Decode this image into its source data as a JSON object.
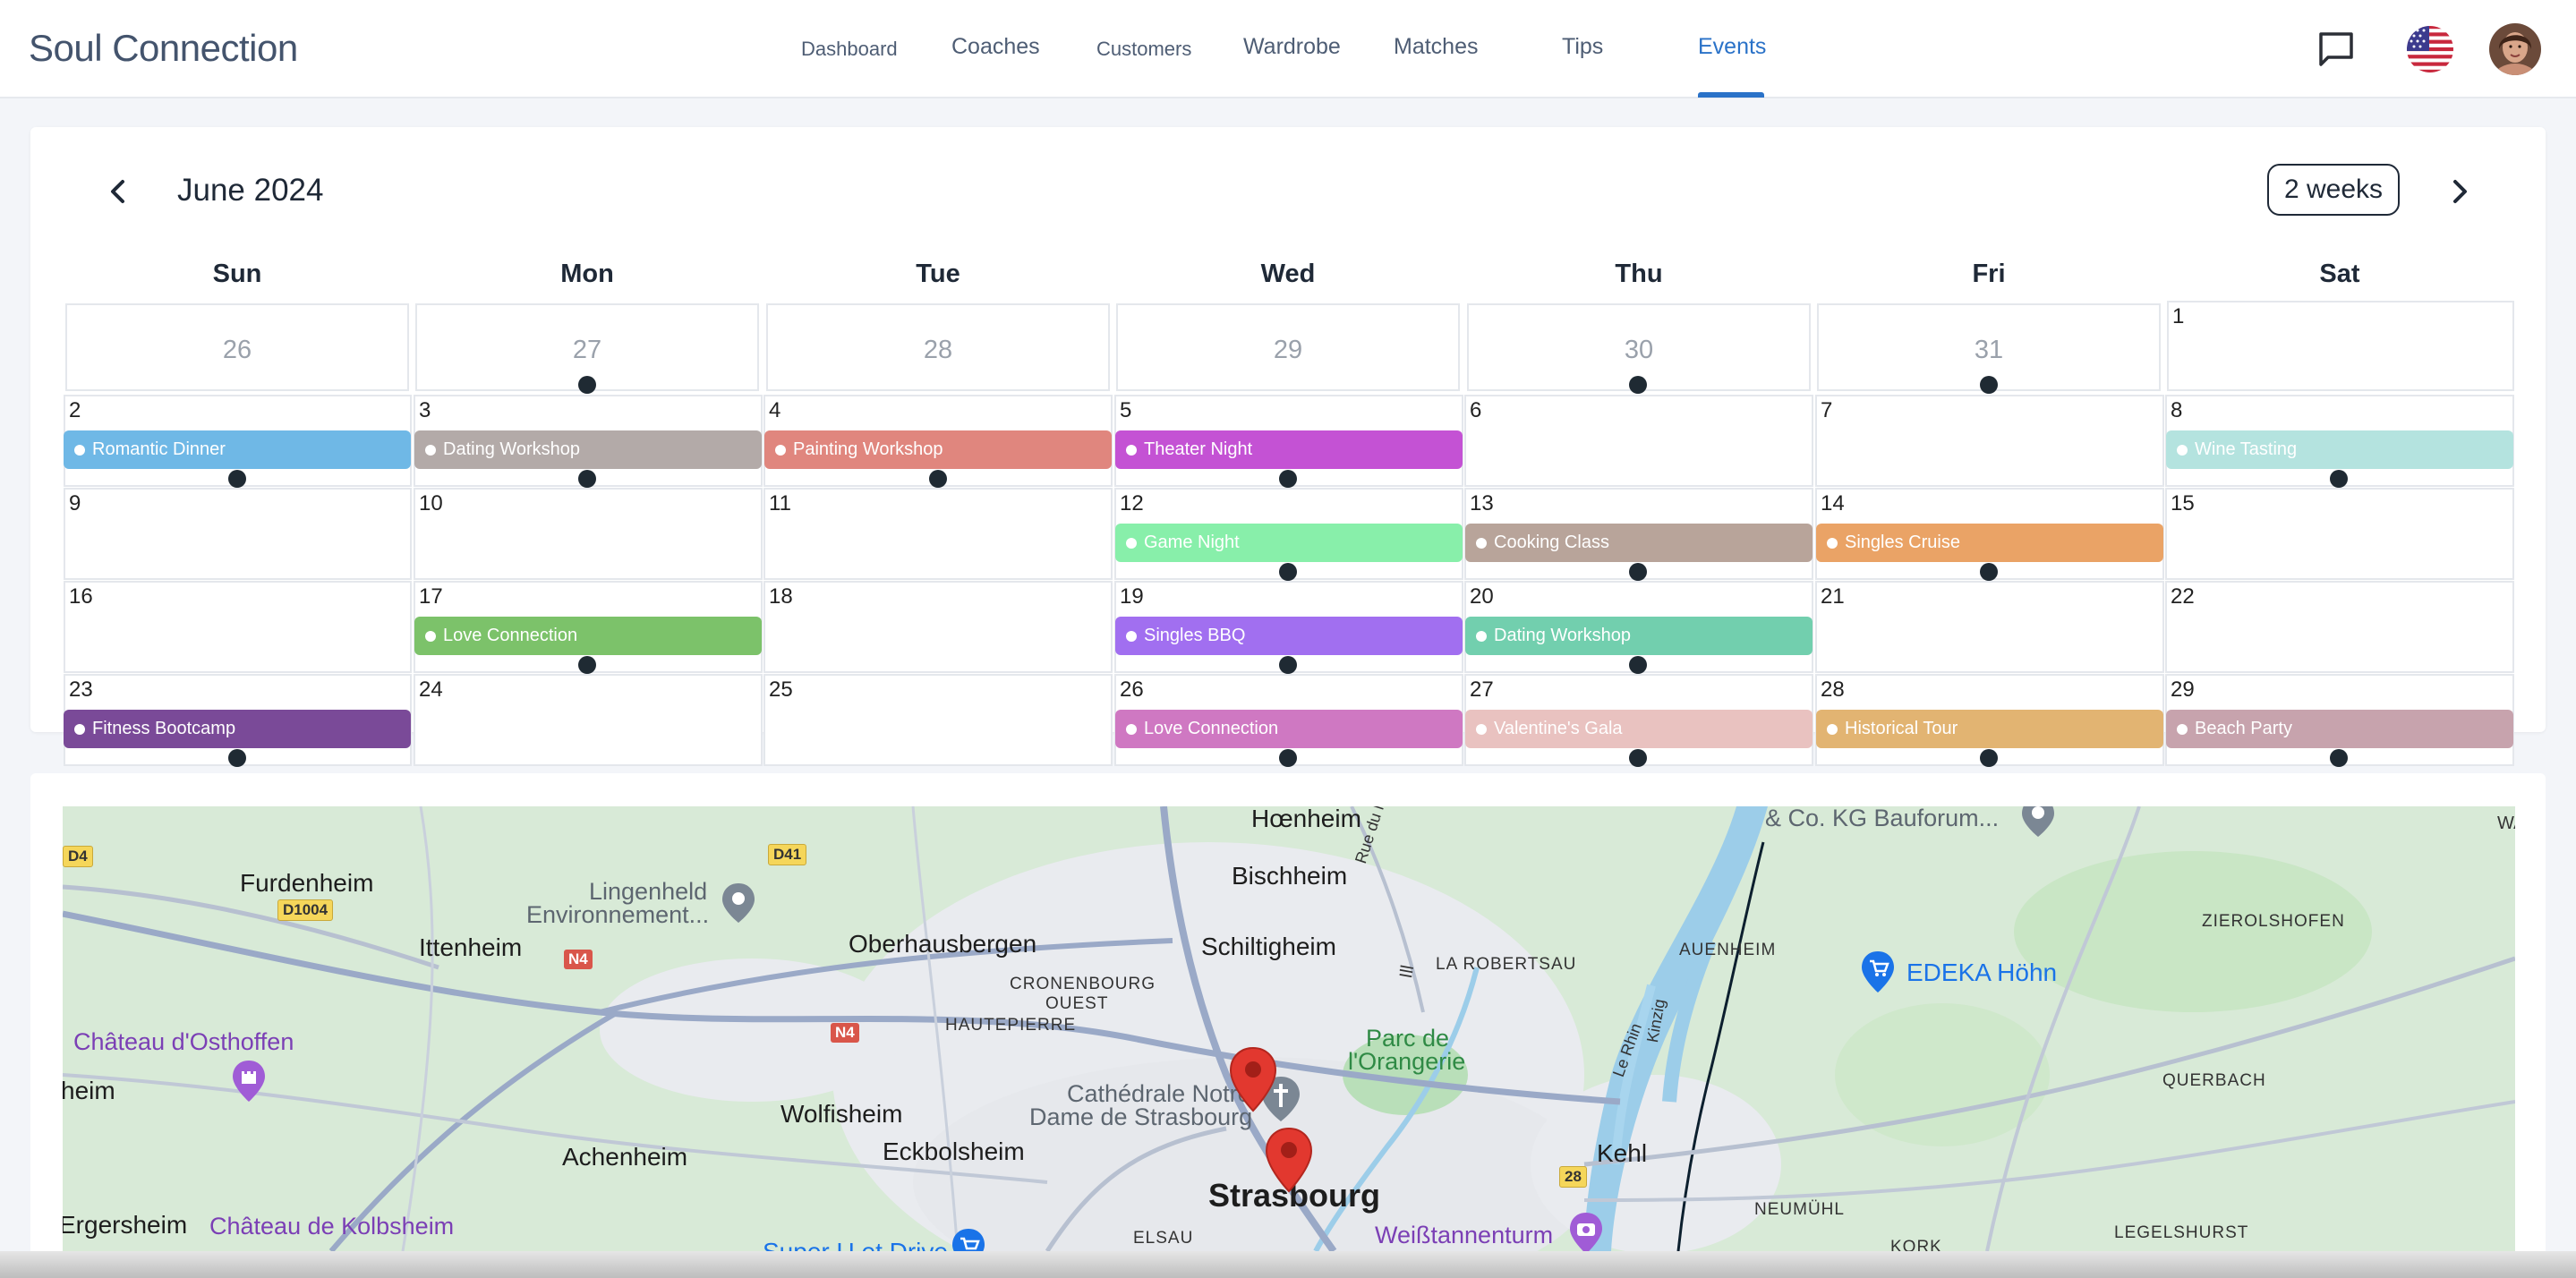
{
  "header": {
    "brand": "Soul Connection",
    "nav": [
      {
        "label": "Dashboard"
      },
      {
        "label": "Coaches"
      },
      {
        "label": "Customers"
      },
      {
        "label": "Wardrobe"
      },
      {
        "label": "Matches"
      },
      {
        "label": "Tips"
      },
      {
        "label": "Events"
      }
    ],
    "active_nav": "Events",
    "icons": [
      "chat-icon",
      "us-flag-icon",
      "avatar"
    ]
  },
  "calendar": {
    "title": "June 2024",
    "view_label": "2 weeks",
    "days_of_week": [
      "Sun",
      "Mon",
      "Tue",
      "Wed",
      "Thu",
      "Fri",
      "Sat"
    ],
    "prev_month_days": [
      "26",
      "27",
      "28",
      "29",
      "30",
      "31"
    ],
    "dates": [
      "1",
      "2",
      "3",
      "4",
      "5",
      "6",
      "7",
      "8",
      "9",
      "10",
      "11",
      "12",
      "13",
      "14",
      "15",
      "16",
      "17",
      "18",
      "19",
      "20",
      "21",
      "22",
      "23",
      "24",
      "25",
      "26",
      "27",
      "28",
      "29"
    ],
    "events": [
      {
        "date": "2",
        "title": "Romantic Dinner",
        "color": "#6fb8e6"
      },
      {
        "date": "3",
        "title": "Dating Workshop",
        "color": "#b3aaa8"
      },
      {
        "date": "4",
        "title": "Painting Workshop",
        "color": "#e0867e"
      },
      {
        "date": "5",
        "title": "Theater Night",
        "color": "#c452d4"
      },
      {
        "date": "8",
        "title": "Wine Tasting",
        "color": "#b4e3df"
      },
      {
        "date": "12",
        "title": "Game Night",
        "color": "#88efaa"
      },
      {
        "date": "13",
        "title": "Cooking Class",
        "color": "#b8a49a"
      },
      {
        "date": "14",
        "title": "Singles Cruise",
        "color": "#eaa366"
      },
      {
        "date": "17",
        "title": "Love Connection",
        "color": "#7cc26a"
      },
      {
        "date": "19",
        "title": "Singles BBQ",
        "color": "#a16ff0"
      },
      {
        "date": "20",
        "title": "Dating Workshop",
        "color": "#72cfae"
      },
      {
        "date": "23",
        "title": "Fitness Bootcamp",
        "color": "#7a4a98"
      },
      {
        "date": "26",
        "title": "Love Connection",
        "color": "#cf78c2"
      },
      {
        "date": "27",
        "title": "Valentine's Gala",
        "color": "#e9c2c0"
      },
      {
        "date": "28",
        "title": "Historical Tour",
        "color": "#e2b472"
      },
      {
        "date": "29",
        "title": "Beach Party",
        "color": "#c7a3ad"
      }
    ]
  },
  "map": {
    "labels": {
      "hoenheim": "Hœnheim",
      "bauforum": "& Co. KG Bauforum...",
      "wa": "WA",
      "d4": "D4",
      "furdenheim": "Furdenheim",
      "d1004": "D1004",
      "lingenheld": "Lingenheld",
      "environnement": "Environnement...",
      "d41": "D41",
      "bischheim": "Bischheim",
      "rue_du_marais": "Rue du Marais",
      "schiltigheim": "Schiltigheim",
      "ittenheim": "Ittenheim",
      "n4": "N4",
      "oberhausbergen": "Oberhausbergen",
      "la_robertsau": "LA ROBERTSAU",
      "auenheim": "AUENHEIM",
      "edeka": "EDEKA Höhn",
      "zierolshofen": "ZIEROLSHOFEN",
      "cronenbourg": "CRONENBOURG",
      "ouest": "OUEST",
      "hautepierre": "HAUTEPIERRE",
      "ill": "Ill",
      "chateau_osthoffen": "Château d'Osthoffen",
      "parc_orangerie_1": "Parc de",
      "parc_orangerie_2": "l'Orangerie",
      "kinzig": "Kinzig",
      "le_rhin": "Le Rhin",
      "heim": "heim",
      "cathedrale_1": "Cathédrale Notre",
      "cathedrale_2": "Dame de Strasbourg",
      "querbach": "QUERBACH",
      "wolfisheim": "Wolfisheim",
      "achenheim": "Achenheim",
      "eckbolsheim": "Eckbolsheim",
      "kehl": "Kehl",
      "r28": "28",
      "strasbourg": "Strasbourg",
      "neumuhl": "NEUMÜHL",
      "ergersheim": "Ergersheim",
      "chateau_kolbsheim": "Château de Kolbsheim",
      "super_u": "Super U et Drive",
      "elsau": "ELSAU",
      "weisstannenturm": "Weißtannenturm",
      "kork": "KORK",
      "legelshurst": "LEGELSHURST"
    }
  }
}
